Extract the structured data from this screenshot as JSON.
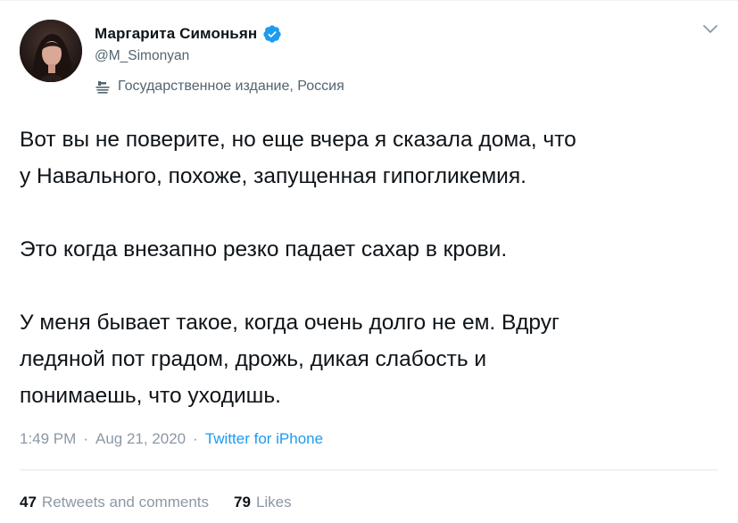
{
  "author": {
    "name": "Маргарита Симоньян",
    "handle": "@M_Simonyan",
    "verified_icon": "verified-badge-icon",
    "label_icon": "state-media-icon",
    "label": "Государственное издание, Россия"
  },
  "tweet": {
    "paragraphs": [
      {
        "lines": [
          "Вот вы не поверите, но еще вчера я сказала дома, что",
          "у Навального, похоже, запущенная гипогликемия."
        ]
      },
      {
        "lines": [
          "Это когда внезапно резко падает сахар в крови."
        ]
      },
      {
        "lines": [
          "У меня бывает такое, когда очень долго не ем. Вдруг",
          "ледяной пот градом, дрожь, дикая слабость и",
          "понимаешь, что уходишь."
        ]
      }
    ]
  },
  "meta": {
    "time": "1:49 PM",
    "separator": "·",
    "date": "Aug 21, 2020",
    "source": "Twitter for iPhone"
  },
  "stats": {
    "retweets_count": "47",
    "retweets_label": "Retweets and comments",
    "likes_count": "79",
    "likes_label": "Likes"
  },
  "menu_icon": "chevron-down-icon",
  "colors": {
    "text": "#0f1419",
    "secondary": "#536471",
    "muted": "#8b98a5",
    "accent": "#1d9bf0",
    "divider": "#e1e8ed"
  }
}
